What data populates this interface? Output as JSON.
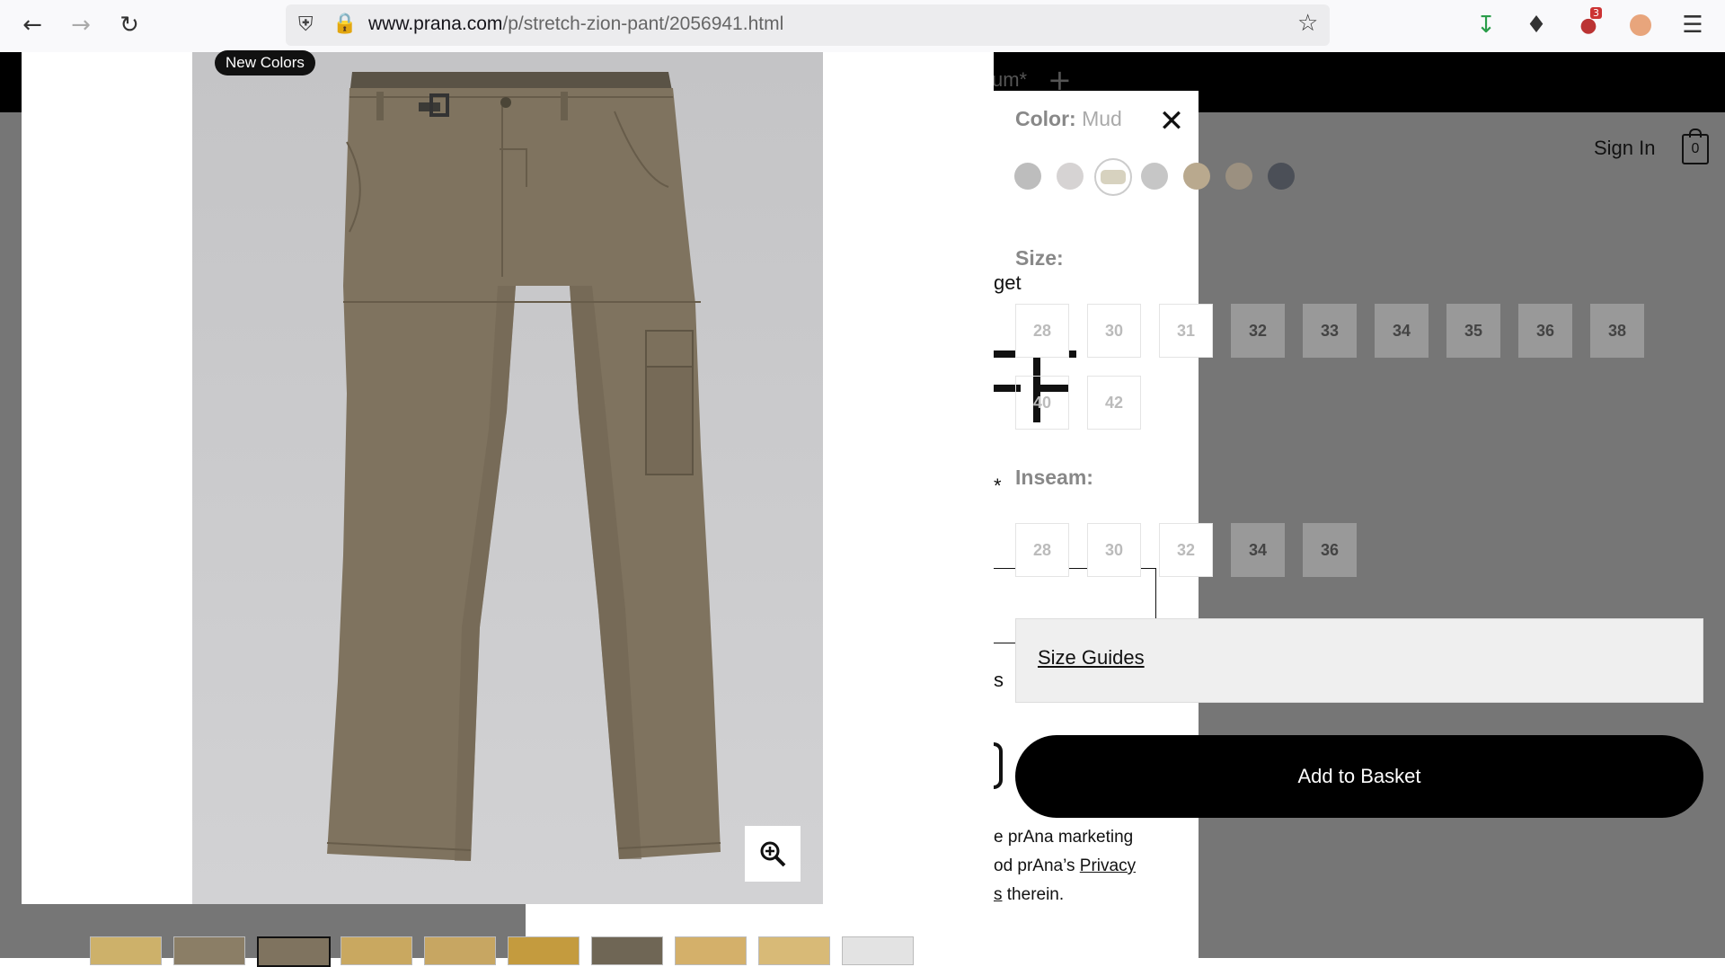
{
  "browser": {
    "url_host": "www.prana.com",
    "url_path": "/p/stretch-zion-pant/2056941.html",
    "notifications_badge": "3"
  },
  "header": {
    "tab_fragment": "um*",
    "sign_in": "Sign In",
    "cart_count": "0"
  },
  "gallery": {
    "badge": "New Colors",
    "zoom_icon": "magnifier-plus-icon"
  },
  "product": {
    "color_label": "Color:",
    "color_value": "Mud",
    "swatches": [
      "#bdbdbd",
      "#d6d3d3",
      "#d7d2bf",
      "#c6c6c6",
      "#b9a98e",
      "#9b9080",
      "#4b4f57"
    ],
    "size_label": "Size:",
    "sizes": [
      {
        "label": "28",
        "available": false
      },
      {
        "label": "30",
        "available": false
      },
      {
        "label": "31",
        "available": false
      },
      {
        "label": "32",
        "available": true
      },
      {
        "label": "33",
        "available": true
      },
      {
        "label": "34",
        "available": true
      },
      {
        "label": "35",
        "available": true
      },
      {
        "label": "36",
        "available": true
      },
      {
        "label": "38",
        "available": true
      },
      {
        "label": "40",
        "available": false
      },
      {
        "label": "42",
        "available": false
      }
    ],
    "inseam_label": "Inseam:",
    "inseams": [
      {
        "label": "28",
        "available": false
      },
      {
        "label": "30",
        "available": false
      },
      {
        "label": "32",
        "available": false
      },
      {
        "label": "34",
        "available": true
      },
      {
        "label": "36",
        "available": true
      }
    ],
    "size_guides": "Size Guides",
    "add_to_basket": "Add to Basket"
  },
  "fragments": {
    "get": "get",
    "s": "s",
    "marketing_line1": "e prAna marketing",
    "marketing_line2_pre": "od prAna’s ",
    "marketing_link": "Privacy",
    "marketing_line3_link": "s",
    "marketing_line3": " therein.",
    "asterisk": "*"
  }
}
